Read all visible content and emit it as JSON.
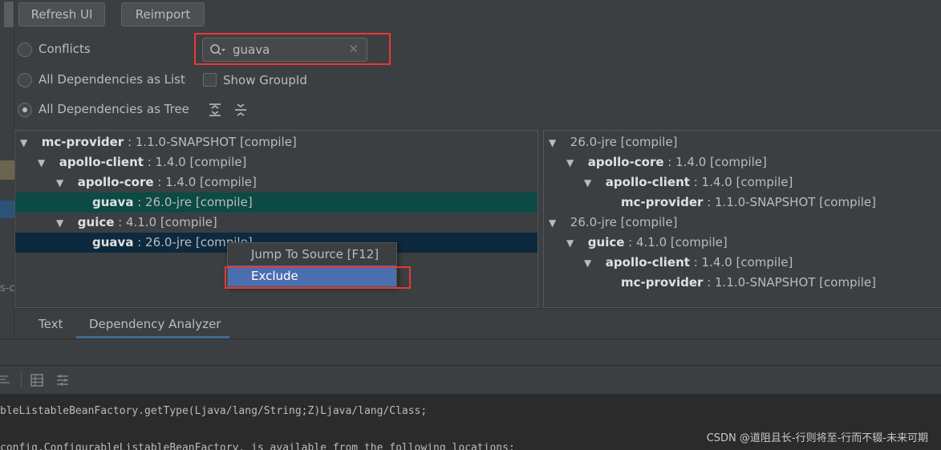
{
  "toolbar": {
    "refresh_label": "Refresh UI",
    "reimport_label": "Reimport"
  },
  "options": {
    "conflicts_label": "Conflicts",
    "list_label": "All Dependencies as List",
    "tree_label": "All Dependencies as Tree",
    "show_groupid_label": "Show GroupId",
    "selected": "All Dependencies as Tree"
  },
  "search": {
    "value": "guava",
    "clear_symbol": "✕"
  },
  "left_tree": [
    {
      "name": "mc-provider",
      "detail": " : 1.1.0-SNAPSHOT [compile]",
      "arrow": "▼"
    },
    {
      "name": "apollo-client",
      "detail": " : 1.4.0 [compile]",
      "arrow": "▼"
    },
    {
      "name": "apollo-core",
      "detail": " : 1.4.0 [compile]",
      "arrow": "▼"
    },
    {
      "name": "guava",
      "detail": " : 26.0-jre [compile]",
      "arrow": ""
    },
    {
      "name": "guice",
      "detail": " : 4.1.0 [compile]",
      "arrow": "▼"
    },
    {
      "name": "guava",
      "detail": " : 26.0-jre [compile]",
      "arrow": ""
    }
  ],
  "right_tree": [
    {
      "name": "",
      "detail": "26.0-jre [compile]",
      "arrow": "▼"
    },
    {
      "name": "apollo-core",
      "detail": " : 1.4.0 [compile]",
      "arrow": "▼"
    },
    {
      "name": "apollo-client",
      "detail": " : 1.4.0 [compile]",
      "arrow": "▼"
    },
    {
      "name": "mc-provider",
      "detail": " : 1.1.0-SNAPSHOT [compile]",
      "arrow": ""
    },
    {
      "name": "",
      "detail": "26.0-jre [compile]",
      "arrow": "▼"
    },
    {
      "name": "guice",
      "detail": " : 4.1.0 [compile]",
      "arrow": "▼"
    },
    {
      "name": "apollo-client",
      "detail": " : 1.4.0 [compile]",
      "arrow": "▼"
    },
    {
      "name": "mc-provider",
      "detail": " : 1.1.0-SNAPSHOT [compile]",
      "arrow": ""
    }
  ],
  "context_menu": {
    "jump_label": "Jump To Source [F12]",
    "exclude_label": "Exclude"
  },
  "tabs": {
    "text_label": "Text",
    "analyzer_label": "Dependency Analyzer"
  },
  "side_fragment": "s-c",
  "console": {
    "line1": "bleListableBeanFactory.getType(Ljava/lang/String;Z)Ljava/lang/Class;",
    "line2": "config.ConfigurableListableBeanFactory, is available from the following locations:"
  },
  "watermark": "CSDN @道阻且长-行则将至-行而不辍-未来可期",
  "colors": {
    "selection_primary": "#0b4a45",
    "selection_secondary": "#0d293e",
    "menu_highlight": "#4b6eaf",
    "annotation_red": "#e53935"
  }
}
